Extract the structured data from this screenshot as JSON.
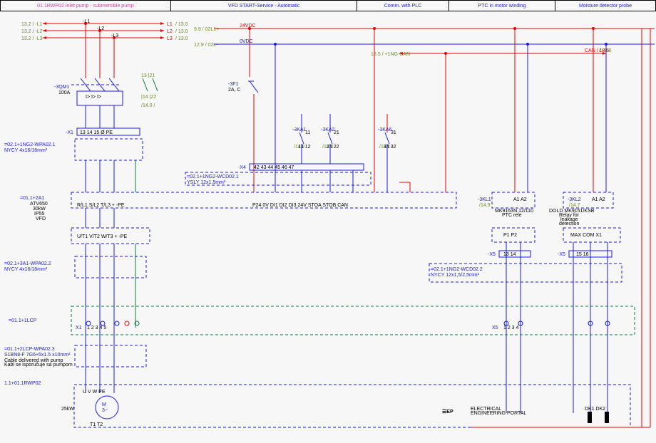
{
  "header": {
    "title": "01.1RWP02 Inlet pump - submersible pump",
    "sec2": "VFD START-Service - Automatic",
    "sec3": "Comm. with PLC",
    "sec4": "PTC in motor winding",
    "sec5": "Moisture detector probe"
  },
  "lines": {
    "L1": "L1",
    "L1ref": "/ 13.0",
    "L2": "L2",
    "L2ref": "/ 13.0",
    "L3": "L3",
    "L3ref": "/ 13.0",
    "L1in": "13.2 / -L1",
    "L2in": "13.2 / -L2",
    "L3in": "13.2 / -L3",
    "p24": "24VDC",
    "p24ref": "9.9 / 02L1+",
    "p0": "0VDC",
    "p0ref": "12.9 / 02L-",
    "canL": "18.5 / +1NG-CAN",
    "canR": "CAN / 18.6"
  },
  "comp": {
    "qm1": "-3QM1",
    "qm1a": "100A",
    "f1": "-3F1",
    "f1a": "2A, C",
    "aux": "13 |21",
    "aux2": "|14 |22",
    "auxref": "/14.0 /",
    "ka1": "-3KA1",
    "ka1ref": "/14.2",
    "ka2": "-3KA2",
    "ka2ref": "/14.2",
    "ka6": "-3KA6",
    "ka6ref": "/14.1",
    "kl1": "-3KL1",
    "kl1ref": "/14.9",
    "kl1desc": "MK9163N.12/110\nPTC rele",
    "kl2": "-3KL2",
    "kl2ref": "/14.7",
    "kl2desc": "DOLD MK9151/KSB\nRelay for\nleakage\ndetection"
  },
  "xterm": {
    "x1": "-X1",
    "x1p": "13  14  15  Ø  PE",
    "x4": "-X4",
    "x4p": "42    43    44    45    46    47",
    "x5a": "-X5",
    "x5a_p": "13  14",
    "x5b": "-X5",
    "x5b_p": "15  16",
    "lcpX1": "X1",
    "lcpX1p": "1  2  3  4  5",
    "lcpX5": "X5",
    "lcpX5p": "1  2  3  4"
  },
  "cables": {
    "c1": "=02.1+1NG2-WPA02.1",
    "c1t": "NYCY 4x16/16mm²",
    "c2": "=02.1+1NG2-WCD02.1",
    "c2t": "YSLY 12x1.5mm²",
    "c3": "=02.1+3A1-WPA02.2",
    "c3t": "NYCY 4x16/16mm²",
    "c4": "=02.1+1NG2-WCD02.2",
    "c4t": "NYCY 12x1,5/2,5mm²",
    "c5": "=01.1+2LCP-WPA02.3",
    "c5t": "S1BN8-F 7G6+5x1.5 x10mm²",
    "c5n": "Cable delivered with pump\nKabl se isporučuje sa pumpom"
  },
  "blocks": {
    "a1": "=01.1+2A1",
    "a1d": "ATV650\n30kW\nIP55\nVFD",
    "a1top": "R/L1  S/L2  T/L3  +  -PE",
    "a1bot": "U/T1  V/T2  W/T3  +  -PE",
    "a1io": "P24   0V   DI1   DI2   DI3   24V   STOA  STOB   CAN",
    "kl1io": "A1  A2",
    "kl1out": "P1  P2",
    "kl2io": "A1  A2",
    "kl2out": "MAX  COM  X1",
    "lcp": "=01.1+1LCP",
    "motor": "1.1+01.1RWP02",
    "motorP": "25kW",
    "motorT": "3~\nM",
    "motorPins": "U   V   W   PE",
    "motorB": "T1        T2",
    "dk": "DK1  DK2"
  },
  "logo": "EEP  ELECTRICAL\nENGINEERING PORTAL"
}
